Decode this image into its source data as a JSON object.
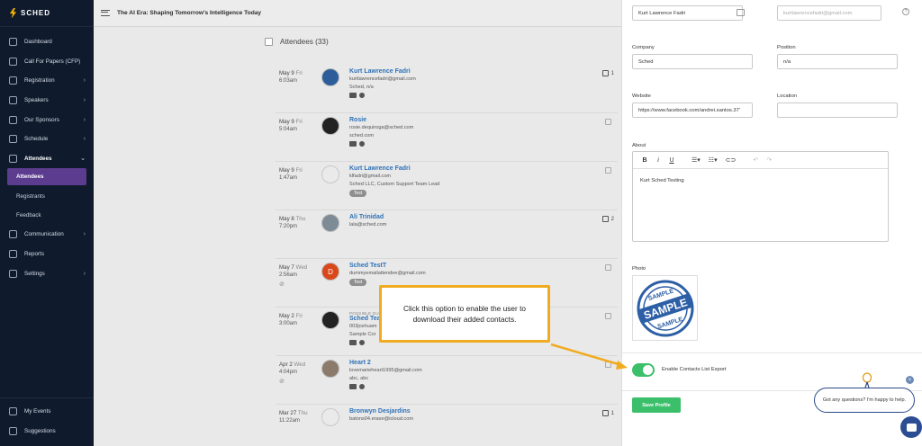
{
  "brand": {
    "name": "SCHED"
  },
  "header": {
    "event_title": "The AI Era: Shaping Tomorrow's Intelligence Today"
  },
  "sidebar": {
    "items": [
      {
        "label": "Dashboard",
        "icon": "dashboard-icon"
      },
      {
        "label": "Call For Papers (CFP)",
        "icon": "document-icon"
      },
      {
        "label": "Registration",
        "icon": "registration-icon",
        "chevron": "›"
      },
      {
        "label": "Speakers",
        "icon": "microphone-icon",
        "chevron": "›"
      },
      {
        "label": "Our Sponsors",
        "icon": "diamond-icon",
        "chevron": "›"
      },
      {
        "label": "Schedule",
        "icon": "calendar-icon",
        "chevron": "›"
      },
      {
        "label": "Attendees",
        "icon": "people-icon",
        "chevron": "⌄"
      }
    ],
    "attendees_sub": [
      "Attendees",
      "Registrants",
      "Feedback"
    ],
    "items2": [
      {
        "label": "Communication",
        "icon": "chat-icon",
        "chevron": "›"
      },
      {
        "label": "Reports",
        "icon": "chart-icon"
      },
      {
        "label": "Settings",
        "icon": "gear-icon",
        "chevron": "›"
      }
    ],
    "bottom": [
      {
        "label": "My Events",
        "icon": "back-arrow-icon"
      },
      {
        "label": "Suggestions",
        "icon": "lightbulb-icon"
      }
    ]
  },
  "attendees": {
    "title": "Attendees (33)",
    "rows": [
      {
        "date": "May 9",
        "day": "Fri",
        "time": "6:03am",
        "pretitle": "",
        "name": "Kurt Lawrence Fadri",
        "lines": [
          "kurtlawrencefadri@gmail.com",
          "Sched, n/a"
        ],
        "tag": "",
        "count": "1"
      },
      {
        "date": "May 9",
        "day": "Fri",
        "time": "5:04am",
        "pretitle": "",
        "name": "Rosie",
        "lines": [
          "rosie.dequiroga@sched.com",
          "sched.com"
        ],
        "tag": "",
        "count": ""
      },
      {
        "date": "May 9",
        "day": "Fri",
        "time": "1:47am",
        "pretitle": "",
        "name": "Kurt Lawrence Fadri",
        "lines": [
          "klfadri@gmail.com",
          "Sched LLC, Custom Support Team Lead"
        ],
        "tag": "Test",
        "count": ""
      },
      {
        "date": "May 8",
        "day": "Thu",
        "time": "7:20pm",
        "pretitle": "",
        "name": "Ali Trinidad",
        "lines": [
          "lala@sched.com"
        ],
        "tag": "",
        "count": "2"
      },
      {
        "date": "May 7",
        "day": "Wed",
        "time": "2:56am",
        "pretitle": "",
        "name": "Sched TestT",
        "lines": [
          "dummyemailattendee@gmail.com"
        ],
        "tag": "Test",
        "count": ""
      },
      {
        "date": "May 2",
        "day": "Fri",
        "time": "3:00am",
        "pretitle": "POSSIBLE DUPL",
        "name": "Sched Tea",
        "lines": [
          "003joshuam",
          "Sample Cor"
        ],
        "tag": "",
        "count": ""
      },
      {
        "date": "Apr 2",
        "day": "Wed",
        "time": "4:04pm",
        "pretitle": "",
        "name": "Heart 2",
        "lines": [
          "lovemarieheart1995@gmail.com",
          "abc, abc"
        ],
        "tag": "",
        "count": ""
      },
      {
        "date": "Mar 27",
        "day": "Thu",
        "time": "11:22am",
        "pretitle": "",
        "name": "Bronwyn Desjardins",
        "lines": [
          "batons04.erase@icloud.com"
        ],
        "tag": "",
        "count": "1"
      }
    ]
  },
  "panel": {
    "name_value": "Kurt Lawrence Fadri",
    "email_value": "kurtlawrencefadri@gmail.com",
    "company_label": "Company",
    "company_value": "Sched",
    "position_label": "Position",
    "position_value": "n/a",
    "website_label": "Website",
    "website_value": "https://www.facebook.com/andrei.santos.37’",
    "location_label": "Location",
    "location_value": "",
    "about_label": "About",
    "about_value": "Kurt Sched Testing",
    "toolbar": {
      "bold": "B",
      "italic": "i",
      "underline": "U"
    },
    "photo_label": "Photo",
    "photo_stamp_top": "SAMPLE",
    "photo_stamp_mid": "SAMPLE",
    "photo_stamp_bottom": "SAMPLE",
    "toggle_label": "Enable Contacts List Export",
    "toggle_on": true,
    "save_label": "Save Profile"
  },
  "callout": {
    "text": "Click this option to enable the user to download their added contacts."
  },
  "chat": {
    "message": "Got any questions? I'm happy to help.",
    "close": "×"
  },
  "colors": {
    "sidebar_bg": "#0f1b2d",
    "accent_purple": "#5b3c8f",
    "green": "#3cbf6a",
    "callout_border": "#f0ab20",
    "link_blue": "#2e72b7"
  }
}
